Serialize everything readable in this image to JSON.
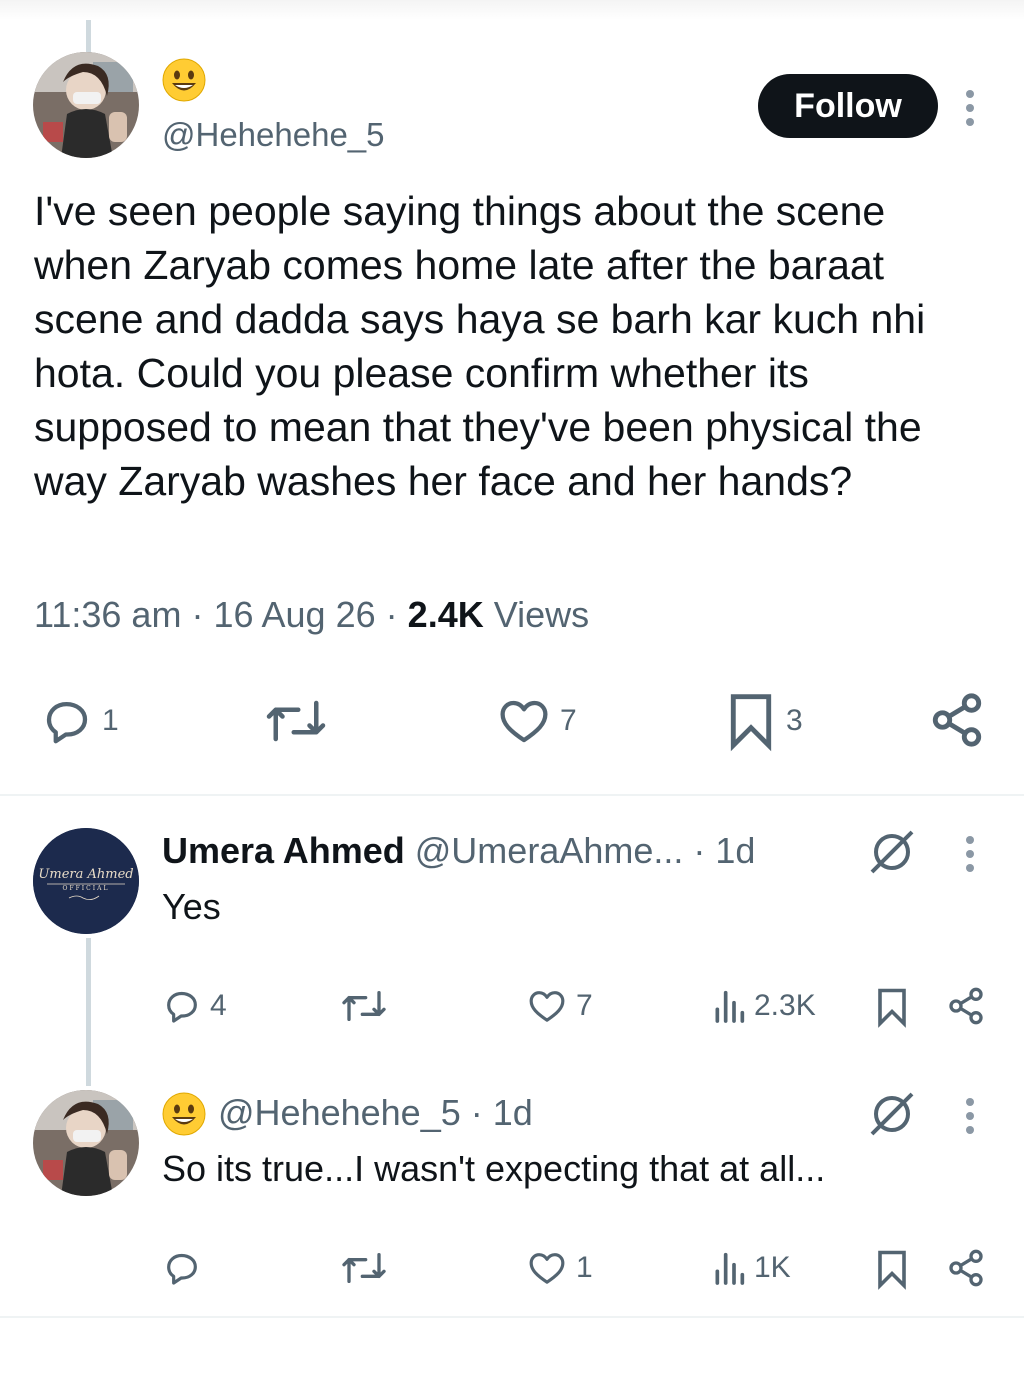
{
  "main_post": {
    "author_emoji": "😀",
    "handle": "@Hehehehe_5",
    "follow_label": "Follow",
    "text": "I've seen people saying things about the scene when Zaryab comes home late after the baraat scene and dadda says haya se barh kar kuch nhi hota. Could you please confirm whether its supposed to mean that they've been physical the way Zaryab washes her face and her hands?",
    "time": "11:36 am",
    "date": "16 Aug 26",
    "views_count": "2.4K",
    "views_label": "Views",
    "separator": "·",
    "actions": {
      "replies": "1",
      "likes": "7",
      "bookmarks": "3"
    }
  },
  "replies": [
    {
      "name": "Umera Ahmed",
      "handle": "@UmeraAhme...",
      "time": "· 1d",
      "text": "Yes",
      "avatar_text": "Umera Ahmed",
      "avatar_sub": "OFFICIAL",
      "stats": {
        "replies": "4",
        "likes": "7",
        "views": "2.3K"
      }
    },
    {
      "emoji": "😀",
      "handle": "@Hehehehe_5",
      "time": "· 1d",
      "text": "So its true...I wasn't expecting that at all...",
      "stats": {
        "replies": "",
        "likes": "1",
        "views": "1K"
      }
    }
  ],
  "colors": {
    "text_primary": "#0f1419",
    "text_secondary": "#536471",
    "follow_bg": "#0f1419",
    "thread_line": "#cfd9de",
    "umera_avatar_bg": "#1c2a4d"
  },
  "icons": [
    "reply-icon",
    "retweet-icon",
    "like-icon",
    "bookmark-icon",
    "share-icon",
    "views-icon",
    "grok-icon",
    "more-icon",
    "smile-emoji-icon"
  ]
}
